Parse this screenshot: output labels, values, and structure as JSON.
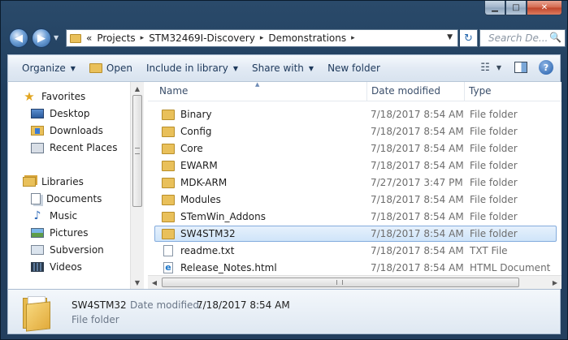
{
  "window": {
    "caption_buttons": {
      "minimize": "▁",
      "maximize": "□",
      "close": "✕"
    }
  },
  "address_bar": {
    "overflow": "«",
    "crumbs": [
      "Projects",
      "STM32469I-Discovery",
      "Demonstrations"
    ],
    "separator": "▸",
    "dropdown": "▼",
    "refresh": "↻"
  },
  "search": {
    "placeholder": "Search De...",
    "icon": "🔍"
  },
  "nav_buttons": {
    "back": "◀",
    "forward": "▶",
    "recent": "▼"
  },
  "toolbar": {
    "organize": "Organize",
    "open": "Open",
    "include_in_library": "Include in library",
    "share_with": "Share with",
    "new_folder": "New folder",
    "dropdown_glyph": "▼",
    "views_glyph": "☷",
    "help_glyph": "?"
  },
  "nav_pane": {
    "favorites": "Favorites",
    "desktop": "Desktop",
    "downloads": "Downloads",
    "recent_places": "Recent Places",
    "libraries": "Libraries",
    "documents": "Documents",
    "music": "Music",
    "pictures": "Pictures",
    "subversion": "Subversion",
    "videos": "Videos",
    "star_glyph": "★",
    "music_glyph": "♪",
    "scroll_up": "▲",
    "scroll_down": "▼"
  },
  "file_list": {
    "columns": {
      "name": "Name",
      "date_modified": "Date modified",
      "type": "Type"
    },
    "sort_glyph": "▲",
    "rows": [
      {
        "name": "Binary",
        "date": "7/18/2017 8:54 AM",
        "type": "File folder",
        "icon": "folder-icon"
      },
      {
        "name": "Config",
        "date": "7/18/2017 8:54 AM",
        "type": "File folder",
        "icon": "folder-icon"
      },
      {
        "name": "Core",
        "date": "7/18/2017 8:54 AM",
        "type": "File folder",
        "icon": "folder-icon"
      },
      {
        "name": "EWARM",
        "date": "7/18/2017 8:54 AM",
        "type": "File folder",
        "icon": "folder-icon"
      },
      {
        "name": "MDK-ARM",
        "date": "7/27/2017 3:47 PM",
        "type": "File folder",
        "icon": "folder-icon"
      },
      {
        "name": "Modules",
        "date": "7/18/2017 8:54 AM",
        "type": "File folder",
        "icon": "folder-icon"
      },
      {
        "name": "STemWin_Addons",
        "date": "7/18/2017 8:54 AM",
        "type": "File folder",
        "icon": "folder-icon"
      },
      {
        "name": "SW4STM32",
        "date": "7/18/2017 8:54 AM",
        "type": "File folder",
        "icon": "folder-icon",
        "selected": true
      },
      {
        "name": "readme.txt",
        "date": "7/18/2017 8:54 AM",
        "type": "TXT File",
        "icon": "text-file-icon"
      },
      {
        "name": "Release_Notes.html",
        "date": "7/18/2017 8:54 AM",
        "type": "HTML Document",
        "icon": "html-file-icon"
      }
    ],
    "hscroll_left": "◀",
    "hscroll_right": "▶"
  },
  "details_pane": {
    "name": "SW4STM32",
    "date_label": "Date modified:",
    "date_value": "7/18/2017 8:54 AM",
    "type": "File folder"
  },
  "colors": {
    "selection_bg": "#cfe4f9",
    "selection_border": "#84acdd",
    "folder": "#e9c05a",
    "toolbar_text": "#1e395b"
  }
}
